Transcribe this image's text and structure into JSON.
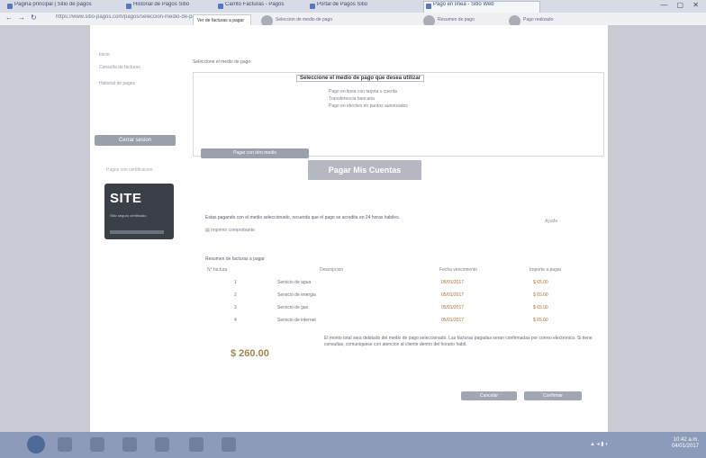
{
  "browser": {
    "tabs": [
      {
        "label": "Pagina principal | Sitio de pagos"
      },
      {
        "label": "Historial de Pagos Sitio"
      },
      {
        "label": "Carrito Facturas - Pagos"
      },
      {
        "label": "Portal de Pagos Sitio"
      },
      {
        "label": "Pago en linea - Sitio Web"
      }
    ],
    "url": "https://www.sitio-pagos.com/pagos/seleccion-medio-de-pago/pago-en-linea",
    "controls": "— ▢ ✕"
  },
  "steps": [
    {
      "label": "Ver de facturas a pagar"
    },
    {
      "label": "Seleccion de medio de pago"
    },
    {
      "label": "Resumen de pago"
    },
    {
      "label": "Pago realizado"
    }
  ],
  "sidebar": {
    "links": [
      "Inicio",
      "Consulta de facturas",
      "Historial de pagos"
    ],
    "button": "Cerrar sesion",
    "footer": "Pagos con certificacion",
    "badge": {
      "logo": "SITE",
      "sub": "Sitio seguro certificado"
    }
  },
  "payment": {
    "section_label": "Seleccione el medio de pago",
    "box_title": "Seleccione el medio de pago que desea utilizar",
    "lines": [
      "Pago en linea con tarjeta o cuenta",
      "Transferencia bancaria",
      "Pago en efectivo en puntos autorizados"
    ],
    "box_button": "Pagar con otro medio",
    "main_button": "Pagar Mis Cuentas"
  },
  "info": {
    "text": "Estas pagando con el medio seleccionado, recuerda que el pago se acredita en 24 horas habiles.",
    "print": "Imprimir comprobante",
    "right": "Ayuda"
  },
  "table": {
    "title": "Resumen de facturas a pagar",
    "headers": {
      "num": "N° factura",
      "desc": "Descripcion",
      "vencimiento": "Fecha vencimiento",
      "importe": "Importe a pagar"
    },
    "rows": [
      {
        "num": "1",
        "desc": "Servicio de agua",
        "venc": "05/01/2017",
        "imp": "$ 65.00"
      },
      {
        "num": "2",
        "desc": "Servicio de energia",
        "venc": "05/01/2017",
        "imp": "$ 65.00"
      },
      {
        "num": "3",
        "desc": "Servicio de gas",
        "venc": "05/01/2017",
        "imp": "$ 65.00"
      },
      {
        "num": "4",
        "desc": "Servicio de internet",
        "venc": "05/01/2017",
        "imp": "$ 65.00"
      }
    ]
  },
  "total": "$ 260.00",
  "note": "El monto total sera debitado del medio de pago seleccionado. Las facturas pagadas seran confirmadas por correo electronico. Si tiene consultas, comuniquese con atencion al cliente dentro del horario habil.",
  "actions": {
    "back": "Cancelar",
    "confirm": "Confirmar"
  },
  "taskbar": {
    "time": "10:42 a.m.",
    "date": "04/01/2017"
  }
}
